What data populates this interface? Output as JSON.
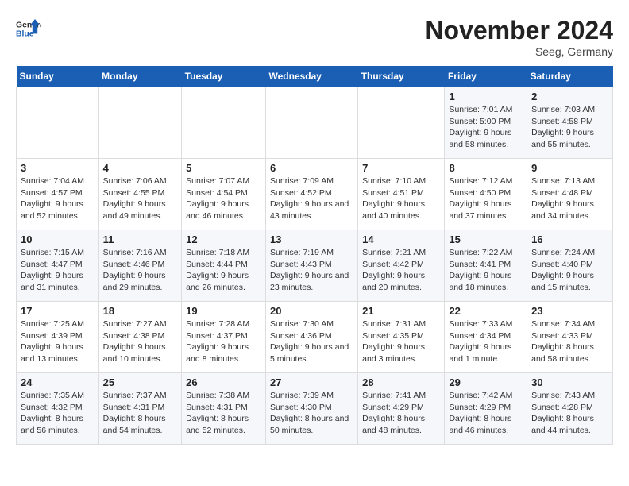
{
  "logo": {
    "general": "General",
    "blue": "Blue"
  },
  "title": "November 2024",
  "subtitle": "Seeg, Germany",
  "days_header": [
    "Sunday",
    "Monday",
    "Tuesday",
    "Wednesday",
    "Thursday",
    "Friday",
    "Saturday"
  ],
  "weeks": [
    [
      {
        "day": "",
        "info": ""
      },
      {
        "day": "",
        "info": ""
      },
      {
        "day": "",
        "info": ""
      },
      {
        "day": "",
        "info": ""
      },
      {
        "day": "",
        "info": ""
      },
      {
        "day": "1",
        "info": "Sunrise: 7:01 AM\nSunset: 5:00 PM\nDaylight: 9 hours and 58 minutes."
      },
      {
        "day": "2",
        "info": "Sunrise: 7:03 AM\nSunset: 4:58 PM\nDaylight: 9 hours and 55 minutes."
      }
    ],
    [
      {
        "day": "3",
        "info": "Sunrise: 7:04 AM\nSunset: 4:57 PM\nDaylight: 9 hours and 52 minutes."
      },
      {
        "day": "4",
        "info": "Sunrise: 7:06 AM\nSunset: 4:55 PM\nDaylight: 9 hours and 49 minutes."
      },
      {
        "day": "5",
        "info": "Sunrise: 7:07 AM\nSunset: 4:54 PM\nDaylight: 9 hours and 46 minutes."
      },
      {
        "day": "6",
        "info": "Sunrise: 7:09 AM\nSunset: 4:52 PM\nDaylight: 9 hours and 43 minutes."
      },
      {
        "day": "7",
        "info": "Sunrise: 7:10 AM\nSunset: 4:51 PM\nDaylight: 9 hours and 40 minutes."
      },
      {
        "day": "8",
        "info": "Sunrise: 7:12 AM\nSunset: 4:50 PM\nDaylight: 9 hours and 37 minutes."
      },
      {
        "day": "9",
        "info": "Sunrise: 7:13 AM\nSunset: 4:48 PM\nDaylight: 9 hours and 34 minutes."
      }
    ],
    [
      {
        "day": "10",
        "info": "Sunrise: 7:15 AM\nSunset: 4:47 PM\nDaylight: 9 hours and 31 minutes."
      },
      {
        "day": "11",
        "info": "Sunrise: 7:16 AM\nSunset: 4:46 PM\nDaylight: 9 hours and 29 minutes."
      },
      {
        "day": "12",
        "info": "Sunrise: 7:18 AM\nSunset: 4:44 PM\nDaylight: 9 hours and 26 minutes."
      },
      {
        "day": "13",
        "info": "Sunrise: 7:19 AM\nSunset: 4:43 PM\nDaylight: 9 hours and 23 minutes."
      },
      {
        "day": "14",
        "info": "Sunrise: 7:21 AM\nSunset: 4:42 PM\nDaylight: 9 hours and 20 minutes."
      },
      {
        "day": "15",
        "info": "Sunrise: 7:22 AM\nSunset: 4:41 PM\nDaylight: 9 hours and 18 minutes."
      },
      {
        "day": "16",
        "info": "Sunrise: 7:24 AM\nSunset: 4:40 PM\nDaylight: 9 hours and 15 minutes."
      }
    ],
    [
      {
        "day": "17",
        "info": "Sunrise: 7:25 AM\nSunset: 4:39 PM\nDaylight: 9 hours and 13 minutes."
      },
      {
        "day": "18",
        "info": "Sunrise: 7:27 AM\nSunset: 4:38 PM\nDaylight: 9 hours and 10 minutes."
      },
      {
        "day": "19",
        "info": "Sunrise: 7:28 AM\nSunset: 4:37 PM\nDaylight: 9 hours and 8 minutes."
      },
      {
        "day": "20",
        "info": "Sunrise: 7:30 AM\nSunset: 4:36 PM\nDaylight: 9 hours and 5 minutes."
      },
      {
        "day": "21",
        "info": "Sunrise: 7:31 AM\nSunset: 4:35 PM\nDaylight: 9 hours and 3 minutes."
      },
      {
        "day": "22",
        "info": "Sunrise: 7:33 AM\nSunset: 4:34 PM\nDaylight: 9 hours and 1 minute."
      },
      {
        "day": "23",
        "info": "Sunrise: 7:34 AM\nSunset: 4:33 PM\nDaylight: 8 hours and 58 minutes."
      }
    ],
    [
      {
        "day": "24",
        "info": "Sunrise: 7:35 AM\nSunset: 4:32 PM\nDaylight: 8 hours and 56 minutes."
      },
      {
        "day": "25",
        "info": "Sunrise: 7:37 AM\nSunset: 4:31 PM\nDaylight: 8 hours and 54 minutes."
      },
      {
        "day": "26",
        "info": "Sunrise: 7:38 AM\nSunset: 4:31 PM\nDaylight: 8 hours and 52 minutes."
      },
      {
        "day": "27",
        "info": "Sunrise: 7:39 AM\nSunset: 4:30 PM\nDaylight: 8 hours and 50 minutes."
      },
      {
        "day": "28",
        "info": "Sunrise: 7:41 AM\nSunset: 4:29 PM\nDaylight: 8 hours and 48 minutes."
      },
      {
        "day": "29",
        "info": "Sunrise: 7:42 AM\nSunset: 4:29 PM\nDaylight: 8 hours and 46 minutes."
      },
      {
        "day": "30",
        "info": "Sunrise: 7:43 AM\nSunset: 4:28 PM\nDaylight: 8 hours and 44 minutes."
      }
    ]
  ]
}
